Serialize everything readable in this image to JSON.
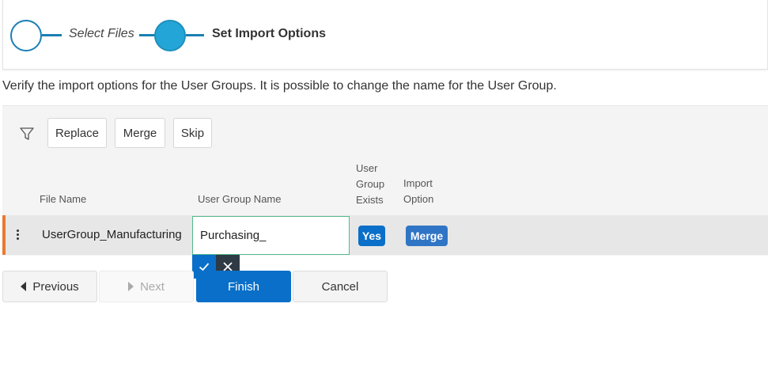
{
  "wizard": {
    "steps": [
      {
        "label": "Select Files",
        "state": "completed"
      },
      {
        "label": "Set Import Options",
        "state": "active"
      }
    ]
  },
  "instructions": "Verify the import options for the User Groups. It is possible to change the name for the User Group.",
  "toolbar": {
    "filter_icon": "filter-icon",
    "replace_label": "Replace",
    "merge_label": "Merge",
    "skip_label": "Skip"
  },
  "columns": {
    "file_name": "File Name",
    "user_group_name": "User Group Name",
    "user_group_exists": [
      "User",
      "Group",
      "Exists"
    ],
    "import_option": [
      "Import",
      "Option"
    ]
  },
  "rows": [
    {
      "file_name": "UserGroup_Manufacturing",
      "user_group_name": "Purchasing_",
      "exists": "Yes",
      "import_option": "Merge"
    }
  ],
  "edit_actions": {
    "confirm_icon": "check-icon",
    "cancel_icon": "close-icon"
  },
  "navigation": {
    "previous_label": "Previous",
    "next_label": "Next",
    "finish_label": "Finish",
    "cancel_label": "Cancel"
  },
  "colors": {
    "accent": "#0a6fc8",
    "step_active": "#23a6d7",
    "row_marker": "#e9792e",
    "edit_border": "#55b98e"
  }
}
